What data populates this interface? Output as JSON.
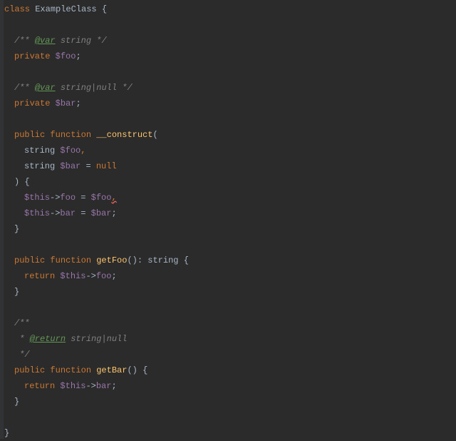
{
  "tokens": {
    "class": "class",
    "className": "ExampleClass",
    "openBrace": "{",
    "closeBrace": "}",
    "docStart": "/**",
    "docEnd": "*/",
    "docStar": " *",
    "varTag": "@var",
    "returnTag": "@return",
    "typeString": "string",
    "typeNull": "null",
    "pipe": "|",
    "private": "private",
    "public": "public",
    "function": "function",
    "return": "return",
    "construct": "__construct",
    "getFoo": "getFoo",
    "getBar": "getBar",
    "foo": "$foo",
    "bar": "$bar",
    "this": "$this",
    "fooProp": "foo",
    "barProp": "bar",
    "semi": ";",
    "comma": ",",
    "colon": ":",
    "openParen": "(",
    "closeParen": ")",
    "eq": "=",
    "arrow": "->",
    "nullKw": "null"
  }
}
